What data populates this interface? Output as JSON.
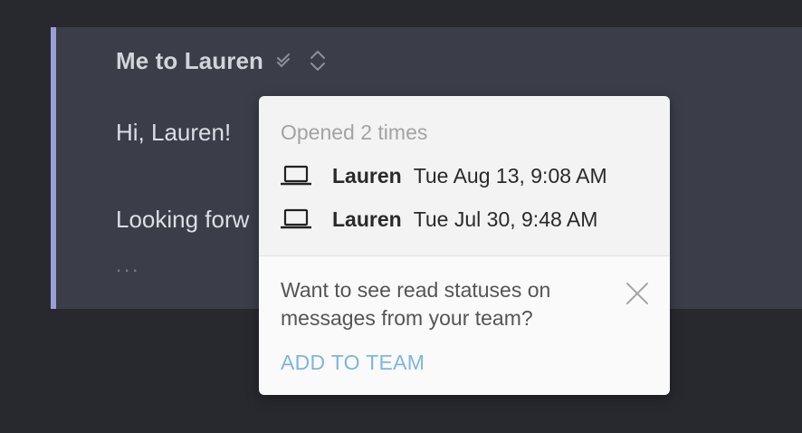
{
  "thread": {
    "title": "Me to Lauren",
    "body_lines": [
      "Hi, Lauren!",
      "Looking forw"
    ],
    "ellipsis": "...",
    "accent_color": "#9a9fd6",
    "icons": [
      "double-check-icon",
      "expand-collapse-icon"
    ]
  },
  "popover": {
    "opened_label": "Opened 2 times",
    "opens": [
      {
        "device_icon": "laptop-icon",
        "name": "Lauren",
        "time": "Tue Aug 13, 9:08 AM"
      },
      {
        "device_icon": "laptop-icon",
        "name": "Lauren",
        "time": "Tue Jul 30, 9:48 AM"
      }
    ],
    "team_prompt": "Want to see read statuses on messages from your team?",
    "add_to_team_label": "ADD TO TEAM",
    "link_color": "#7db6de",
    "close_icon": "close-icon"
  }
}
